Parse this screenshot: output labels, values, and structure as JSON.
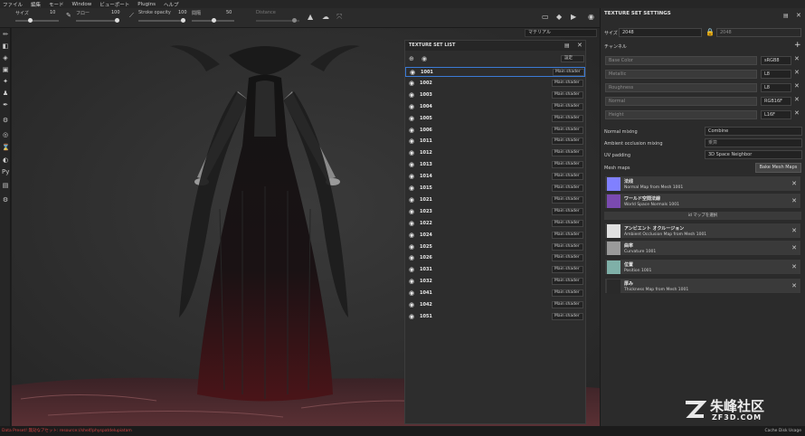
{
  "menu": [
    "ファイル",
    "編集",
    "モード",
    "Window",
    "ビューポート",
    "Plugins",
    "ヘルプ"
  ],
  "toolbar": {
    "size_label": "サイズ",
    "size_val": "10",
    "flow_label": "フロー",
    "flow_val": "100",
    "stroke_label": "Stroke opacity",
    "stroke_val": "100",
    "spacing_label": "間隔",
    "spacing_val": "50",
    "distance_label": "Distance"
  },
  "material_select": "マテリアル",
  "tsl": {
    "title": "TEXTURE SET LIST",
    "settings_label": "設定",
    "shader_label": "Main shader",
    "rows": [
      "1001",
      "1002",
      "1003",
      "1004",
      "1005",
      "1006",
      "1011",
      "1012",
      "1013",
      "1014",
      "1015",
      "1021",
      "1023",
      "1022",
      "1024",
      "1025",
      "1026",
      "1031",
      "1032",
      "1041",
      "1042",
      "1051"
    ]
  },
  "tss": {
    "title": "TEXTURE SET SETTINGS",
    "size_label": "サイズ",
    "size_value": "2048",
    "size_value2": "2048",
    "channels_label": "チャンネル",
    "channels": [
      {
        "name": "Base Color",
        "fmt": "sRGB8"
      },
      {
        "name": "Metallic",
        "fmt": "L8"
      },
      {
        "name": "Roughness",
        "fmt": "L8"
      },
      {
        "name": "Normal",
        "fmt": "RGB16F"
      },
      {
        "name": "Height",
        "fmt": "L16F"
      }
    ],
    "normal_mixing_label": "Normal mixing",
    "normal_mixing_value": "Combine",
    "ao_mixing_label": "Ambient occlusion mixing",
    "ao_mixing_value": "乗算",
    "uv_padding_label": "UV padding",
    "uv_padding_value": "3D Space Neighbor",
    "mesh_maps_label": "Mesh maps",
    "bake_button": "Bake Mesh Maps",
    "select_map_label": "id マップを選択",
    "maps": [
      {
        "t1": "法线",
        "t2": "Normal Map from Mesh 1001",
        "color": "#8080ff"
      },
      {
        "t1": "ワールド空間法線",
        "t2": "World Space Normals 1001",
        "color": "#7a4ab0"
      },
      {
        "t1": "アンビエント オクルージョン",
        "t2": "Ambient Occlusion Map from Mesh 1001",
        "color": "#e0e0e0"
      },
      {
        "t1": "曲率",
        "t2": "Curvature 1001",
        "color": "#9a9a9a"
      },
      {
        "t1": "位置",
        "t2": "Position 1001",
        "color": "#7fb0a8"
      },
      {
        "t1": "厚み",
        "t2": "Thickness Map from Mesh 1001",
        "color": "#2a2a2a"
      }
    ]
  },
  "status": "Data Preset! 無効なアセット: resource://shelf/physpatdelupiatam",
  "status_right": "Cache Disk Usage",
  "watermark": {
    "brand": "朱峰社区",
    "url": "ZF3D.COM"
  }
}
